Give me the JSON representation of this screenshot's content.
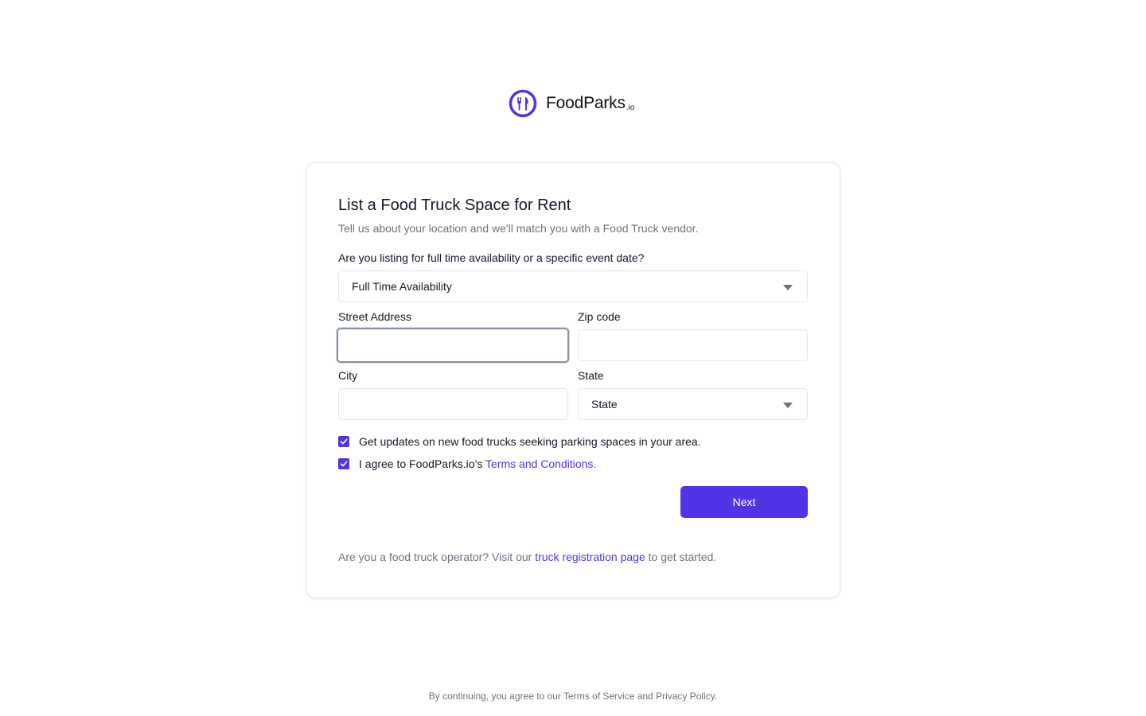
{
  "brand": {
    "name": "FoodParks",
    "suffix": ".io",
    "logo_icon": "fork-knife-icon",
    "accent_color": "#4f35e6"
  },
  "form": {
    "title": "List a Food Truck Space for Rent",
    "subtitle": "Tell us about your location and we'll match you with a Food Truck vendor.",
    "availability": {
      "label": "Are you listing for full time availability or a specific event date?",
      "selected": "Full Time Availability"
    },
    "street": {
      "label": "Street Address",
      "value": ""
    },
    "zip": {
      "label": "Zip code",
      "value": ""
    },
    "city": {
      "label": "City",
      "value": ""
    },
    "state": {
      "label": "State",
      "selected": "State"
    },
    "updates_checkbox": {
      "label": "Get updates on new food trucks seeking parking spaces in your area.",
      "checked": true
    },
    "terms_checkbox": {
      "label_prefix": "I agree to FoodParks.io’s ",
      "link_text": "Terms and Conditions",
      "label_suffix": ".",
      "checked": true
    },
    "next_label": "Next",
    "operator_prompt": {
      "prefix": "Are you a food truck operator? Visit our ",
      "link_text": "truck registration page",
      "suffix": " to get started."
    }
  },
  "footer": {
    "text": "By continuing, you agree to our Terms of Service and Privacy Policy."
  }
}
